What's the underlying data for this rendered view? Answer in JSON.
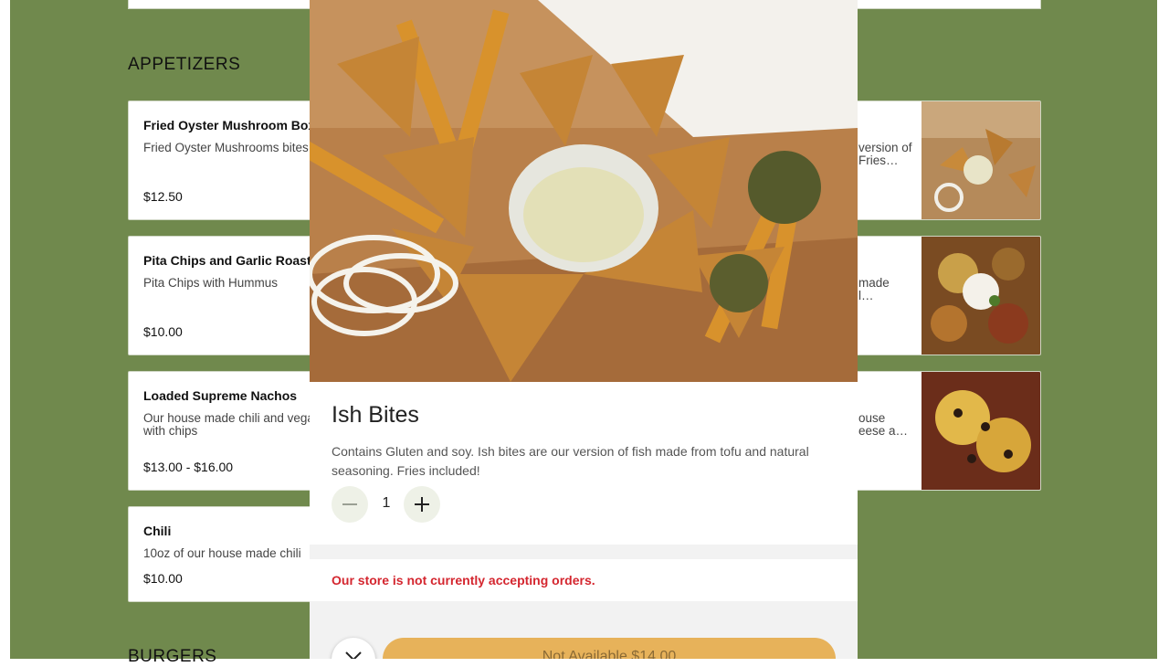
{
  "sections": {
    "appetizers": "APPETIZERS",
    "burgers": "BURGERS"
  },
  "items": [
    {
      "name": "Fried Oyster Mushroom Box",
      "description": "Fried Oyster Mushrooms bites, BBQ sauce and Ranch",
      "price": "$12.50"
    },
    {
      "name": "Pita Chips and Garlic Roasted Hummus",
      "description": "Pita Chips with Hummus",
      "price": "$10.00"
    },
    {
      "name": "Loaded Supreme Nachos",
      "description": "Our house made chili and vegan seasonings. Served with chips",
      "price": "$13.00 - $16.00"
    },
    {
      "name": "Chili",
      "description": "10oz of our house made chili",
      "price": "$10.00"
    }
  ],
  "right_items": [
    {
      "desc_line1": "version of",
      "desc_line2": "Fries…"
    },
    {
      "desc_line1": "made",
      "desc_line2": "l…"
    },
    {
      "desc_line1": "ouse",
      "desc_line2": "eese a…"
    }
  ],
  "modal": {
    "title": "Ish Bites",
    "description": "Contains Gluten and soy. Ish bites are our version of fish made from tofu and natural seasoning. Fries included!",
    "quantity": "1",
    "notice": "Our store is not currently accepting orders.",
    "action_label": "Not Available  $14.00"
  },
  "colors": {
    "page_bg": "#70894d",
    "notice": "#d4262f",
    "action_button": "#e7b25a"
  }
}
